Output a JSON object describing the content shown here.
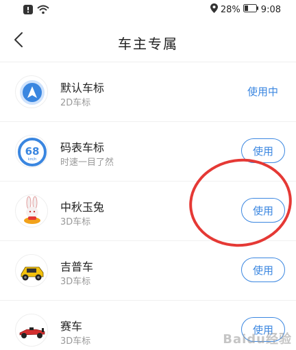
{
  "status_bar": {
    "battery_percent": "28%",
    "time": "9:08",
    "icons": [
      "alert-icon",
      "wifi-icon",
      "location-icon",
      "battery-icon"
    ]
  },
  "header": {
    "title": "车主专属",
    "back_icon": "chevron-left-icon"
  },
  "items": [
    {
      "title": "默认车标",
      "subtitle": "2D车标",
      "action": "使用中",
      "action_type": "text",
      "icon": "navigation-arrow-icon"
    },
    {
      "title": "码表车标",
      "subtitle": "时速一目了然",
      "action": "使用",
      "action_type": "button",
      "icon": "speedometer-icon",
      "speed_value": "68",
      "speed_unit": "km/h"
    },
    {
      "title": "中秋玉兔",
      "subtitle": "3D车标",
      "action": "使用",
      "action_type": "button",
      "icon": "rabbit-icon"
    },
    {
      "title": "吉普车",
      "subtitle": "3D车标",
      "action": "使用",
      "action_type": "button",
      "icon": "jeep-car-icon"
    },
    {
      "title": "赛车",
      "subtitle": "3D车标",
      "action": "使用",
      "action_type": "button",
      "icon": "race-car-icon"
    }
  ],
  "colors": {
    "accent": "#3a86e0",
    "highlight": "#e53935"
  },
  "watermark": "Baidu经验"
}
